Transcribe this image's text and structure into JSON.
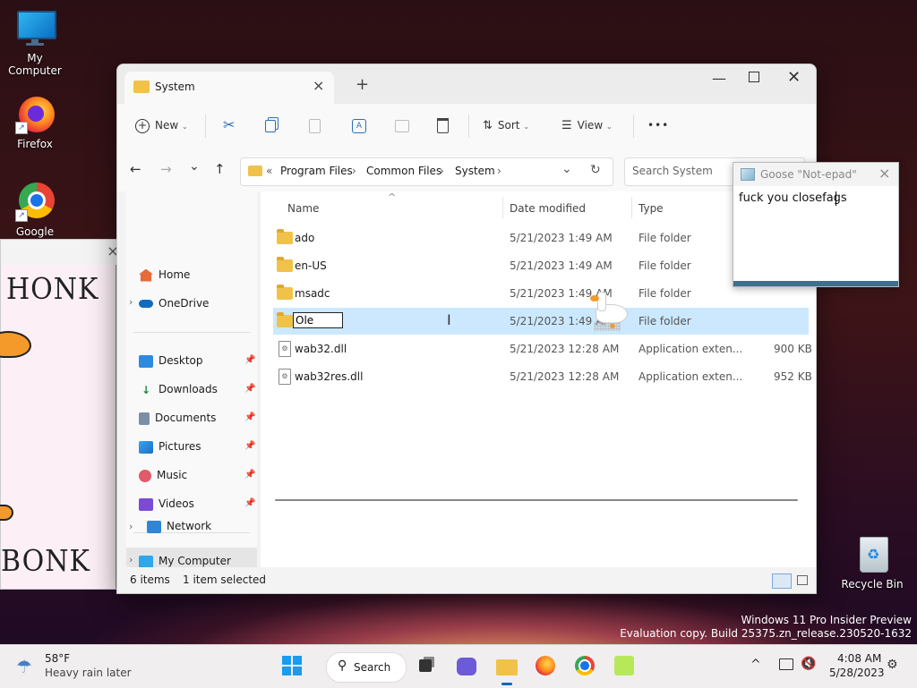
{
  "desktop": {
    "icons": [
      {
        "label": "My Computer"
      },
      {
        "label": "Firefox"
      },
      {
        "label": "Google"
      },
      {
        "label": "Recycle Bin"
      }
    ],
    "watermark_line1": "Windows 11 Pro Insider Preview",
    "watermark_line2": "Evaluation copy. Build 25375.zn_release.230520-1632"
  },
  "explorer": {
    "tab_title": "System",
    "new_tab": "+",
    "toolbar": {
      "new": "New",
      "sort": "Sort",
      "view": "View",
      "more": "•••"
    },
    "breadcrumb": {
      "overflow": "«",
      "items": [
        "Program Files",
        "Common Files",
        "System"
      ]
    },
    "search_placeholder": "Search System",
    "nav": {
      "home": "Home",
      "onedrive": "OneDrive",
      "desktop": "Desktop",
      "downloads": "Downloads",
      "documents": "Documents",
      "pictures": "Pictures",
      "music": "Music",
      "videos": "Videos",
      "my_computer": "My Computer",
      "network": "Network"
    },
    "columns": {
      "name": "Name",
      "date": "Date modified",
      "type": "Type"
    },
    "files": [
      {
        "name": "ado",
        "date": "5/21/2023 1:49 AM",
        "type": "File folder",
        "size": "",
        "icon": "folder-icon"
      },
      {
        "name": "en-US",
        "date": "5/21/2023 1:49 AM",
        "type": "File folder",
        "size": "",
        "icon": "folder-icon"
      },
      {
        "name": "msadc",
        "date": "5/21/2023 1:49 AM",
        "type": "File folder",
        "size": "",
        "icon": "folder-icon"
      },
      {
        "name": "Ole",
        "date": "5/21/2023 1:49 AM",
        "type": "File folder",
        "size": "",
        "icon": "folder-icon"
      },
      {
        "name": "wab32.dll",
        "date": "5/21/2023 12:28 AM",
        "type": "Application exten...",
        "size": "900 KB",
        "icon": "dll-file-icon"
      },
      {
        "name": "wab32res.dll",
        "date": "5/21/2023 12:28 AM",
        "type": "Application exten...",
        "size": "952 KB",
        "icon": "dll-file-icon"
      }
    ],
    "rename_value": "Ole",
    "status": {
      "items": "6 items",
      "selected": "1 item selected"
    }
  },
  "notepad": {
    "title": "Goose \"Not-epad\"",
    "text": "fuck you closefags"
  },
  "honk": {
    "top_text": "HONK",
    "bottom_text": "BONK"
  },
  "taskbar": {
    "weather_temp": "58°F",
    "weather_desc": "Heavy rain later",
    "search": "Search",
    "time": "4:08 AM",
    "date": "5/28/2023"
  },
  "colors": {
    "accent": "#0067c0",
    "selection": "#cce8ff",
    "folder": "#f1c249"
  }
}
